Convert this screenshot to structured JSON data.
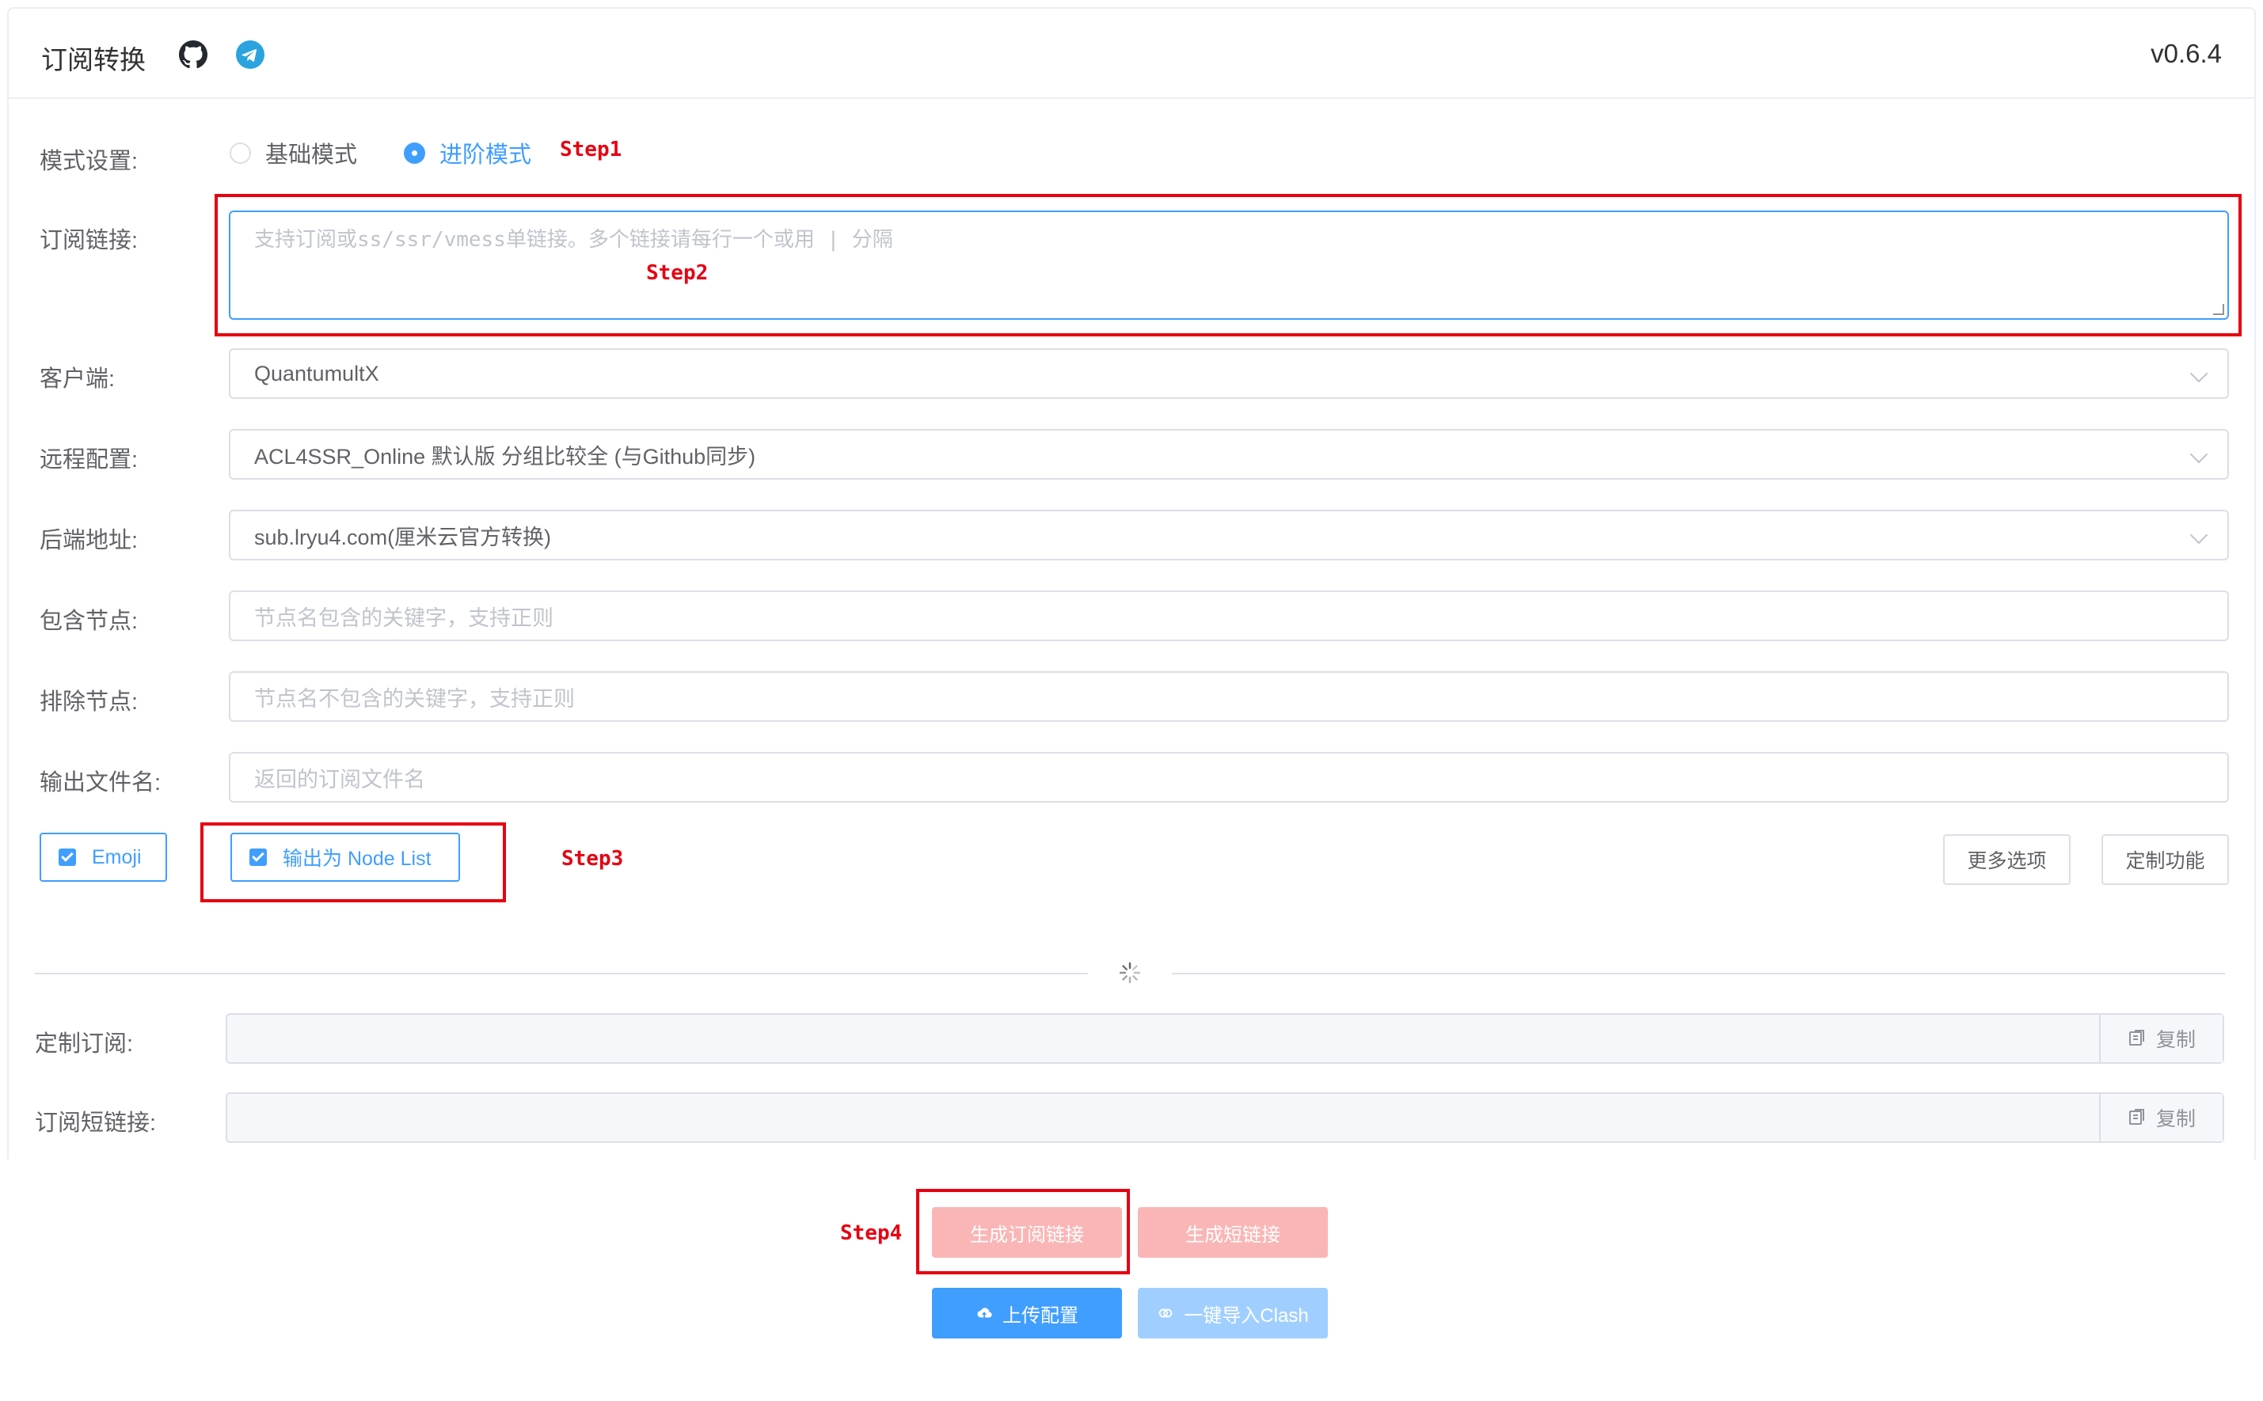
{
  "header": {
    "title": "订阅转换",
    "version": "v0.6.4",
    "icons": [
      "github-icon",
      "telegram-icon"
    ]
  },
  "form": {
    "mode": {
      "label": "模式设置:",
      "options": [
        {
          "label": "基础模式",
          "selected": false
        },
        {
          "label": "进阶模式",
          "selected": true
        }
      ]
    },
    "subscription": {
      "label": "订阅链接:",
      "placeholder": "支持订阅或ss/ssr/vmess单链接。多个链接请每行一个或用 | 分隔",
      "value": ""
    },
    "client": {
      "label": "客户端:",
      "value": "QuantumultX"
    },
    "remote_config": {
      "label": "远程配置:",
      "value": "ACL4SSR_Online 默认版 分组比较全 (与Github同步)"
    },
    "backend": {
      "label": "后端地址:",
      "value": "sub.lryu4.com(厘米云官方转换)"
    },
    "include_nodes": {
      "label": "包含节点:",
      "placeholder": "节点名包含的关键字，支持正则"
    },
    "exclude_nodes": {
      "label": "排除节点:",
      "placeholder": "节点名不包含的关键字，支持正则"
    },
    "filename": {
      "label": "输出文件名:",
      "placeholder": "返回的订阅文件名"
    },
    "checkboxes": [
      {
        "label": "Emoji",
        "checked": true
      },
      {
        "label": "输出为 Node List",
        "checked": true
      }
    ],
    "more_options_label": "更多选项",
    "custom_features_label": "定制功能"
  },
  "results": {
    "custom_sub_label": "定制订阅:",
    "short_link_label": "订阅短链接:",
    "copy_label": "复制"
  },
  "actions": {
    "generate_sub_label": "生成订阅链接",
    "generate_short_label": "生成短链接",
    "upload_config_label": "上传配置",
    "import_clash_label": "一键导入Clash"
  },
  "annotations": {
    "step1": "Step1",
    "step2": "Step2",
    "step3": "Step3",
    "step4": "Step4"
  },
  "colors": {
    "accent": "#409eff",
    "annotation_red": "#e60012",
    "danger_light": "#fab6b6",
    "primary_light": "#a0cfff"
  }
}
